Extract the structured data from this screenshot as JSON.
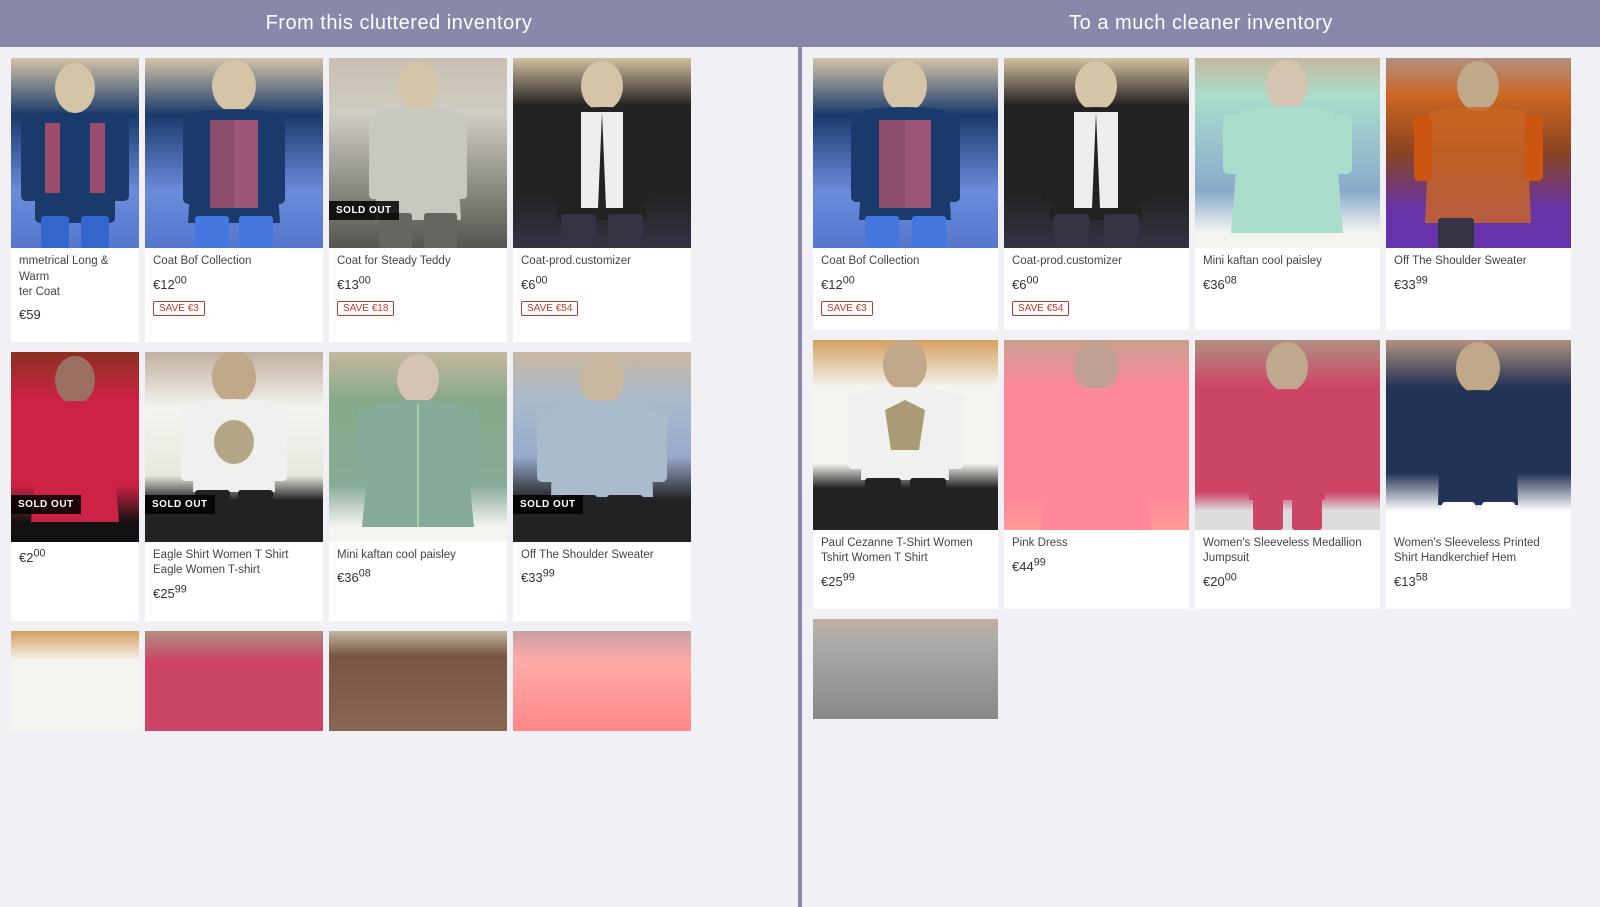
{
  "leftPanel": {
    "header": "From this cluttered inventory",
    "rows": [
      {
        "cards": [
          {
            "id": "partial-symmetrical",
            "title": "mmetrical Long & Warm\nter Coat",
            "price": "59",
            "priceDecimals": "",
            "soldOut": false,
            "partial": true,
            "figClass": "fig-blonde-coat",
            "saveAmount": null
          },
          {
            "id": "coat-bof",
            "title": "Coat Bof Collection",
            "price": "12",
            "priceDecimals": "00",
            "soldOut": false,
            "saveAmount": "€3",
            "figClass": "fig-blonde-coat"
          },
          {
            "id": "coat-steady",
            "title": "Coat for Steady Teddy",
            "price": "13",
            "priceDecimals": "00",
            "soldOut": true,
            "saveAmount": "€18",
            "figClass": "fig-grey-coat"
          },
          {
            "id": "coat-prod",
            "title": "Coat-prod.customizer",
            "price": "6",
            "priceDecimals": "00",
            "soldOut": false,
            "saveAmount": "€54",
            "figClass": "fig-black-jacket"
          }
        ]
      },
      {
        "cards": [
          {
            "id": "partial-dress",
            "title": "",
            "price": "2",
            "priceDecimals": "00",
            "soldOut": true,
            "partial": true,
            "figClass": "fig-brunette-red",
            "saveAmount": null
          },
          {
            "id": "eagle-shirt",
            "title": "Eagle Shirt Women T Shirt\nEagle Women T-shirt",
            "price": "25",
            "priceDecimals": "99",
            "soldOut": true,
            "saveAmount": null,
            "figClass": "fig-eagle-tshirt"
          },
          {
            "id": "mini-kaftan",
            "title": "Mini kaftan cool paisley",
            "price": "36",
            "priceDecimals": "08",
            "soldOut": false,
            "saveAmount": null,
            "figClass": "fig-kaftan-green"
          },
          {
            "id": "off-shoulder",
            "title": "Off The Shoulder Sweater",
            "price": "33",
            "priceDecimals": "99",
            "soldOut": true,
            "saveAmount": null,
            "figClass": "fig-shoulder-sweater"
          }
        ]
      },
      {
        "cards": [
          {
            "id": "partial-tshirt",
            "title": "",
            "price": "",
            "priceDecimals": "",
            "soldOut": false,
            "partial": true,
            "figClass": "fig-paul-tshirt",
            "saveAmount": null
          },
          {
            "id": "women-tshirt2",
            "title": "",
            "price": "",
            "priceDecimals": "",
            "soldOut": false,
            "partial": false,
            "figClass": "fig-women-tshirt",
            "saveAmount": null
          },
          {
            "id": "boho-dress",
            "title": "",
            "price": "",
            "priceDecimals": "",
            "soldOut": false,
            "partial": false,
            "figClass": "fig-boho-dress",
            "saveAmount": null
          },
          {
            "id": "strapless-pink",
            "title": "",
            "price": "",
            "priceDecimals": "",
            "soldOut": false,
            "partial": false,
            "figClass": "fig-pink-strapless",
            "saveAmount": null
          }
        ]
      }
    ]
  },
  "rightPanel": {
    "header": "To a much cleaner inventory",
    "rows": [
      {
        "cards": [
          {
            "id": "r-coat-bof",
            "title": "Coat Bof Collection",
            "price": "12",
            "priceDecimals": "00",
            "soldOut": false,
            "saveAmount": "€3",
            "figClass": "fig-blonde-coat"
          },
          {
            "id": "r-coat-prod",
            "title": "Coat-prod.customizer",
            "price": "6",
            "priceDecimals": "00",
            "soldOut": false,
            "saveAmount": "€54",
            "figClass": "fig-black-jacket"
          },
          {
            "id": "r-mini-kaftan",
            "title": "Mini kaftan cool paisley",
            "price": "36",
            "priceDecimals": "08",
            "soldOut": false,
            "saveAmount": null,
            "figClass": "fig-mini-kaftan"
          },
          {
            "id": "r-off-shoulder",
            "title": "Off The Shoulder Sweater",
            "price": "33",
            "priceDecimals": "99",
            "soldOut": false,
            "saveAmount": null,
            "figClass": "fig-colorful-dress"
          }
        ]
      },
      {
        "cards": [
          {
            "id": "r-paul",
            "title": "Paul Cezanne T-Shirt Women Tshirt Women T Shirt",
            "price": "25",
            "priceDecimals": "99",
            "soldOut": false,
            "saveAmount": null,
            "figClass": "fig-paul-tshirt"
          },
          {
            "id": "r-pink-dress",
            "title": "Pink Dress",
            "price": "44",
            "priceDecimals": "99",
            "soldOut": false,
            "saveAmount": null,
            "figClass": "fig-pink-dress"
          },
          {
            "id": "r-medallion",
            "title": "Women's Sleeveless Medallion Jumpsuit",
            "price": "20",
            "priceDecimals": "00",
            "soldOut": false,
            "saveAmount": null,
            "figClass": "fig-medallion"
          },
          {
            "id": "r-printed-shirt",
            "title": "Women's Sleeveless Printed Shirt Handkerchief Hem",
            "price": "13",
            "priceDecimals": "58",
            "soldOut": false,
            "saveAmount": null,
            "figClass": "fig-printed-shirt"
          }
        ]
      },
      {
        "cards": [
          {
            "id": "r-grey-dress",
            "title": "",
            "price": "",
            "priceDecimals": "",
            "soldOut": false,
            "saveAmount": null,
            "figClass": "fig-grey-dress"
          }
        ]
      }
    ]
  },
  "labels": {
    "soldOut": "SOLD OUT",
    "savePrefix": "SAVE ",
    "euroSymbol": "€"
  }
}
